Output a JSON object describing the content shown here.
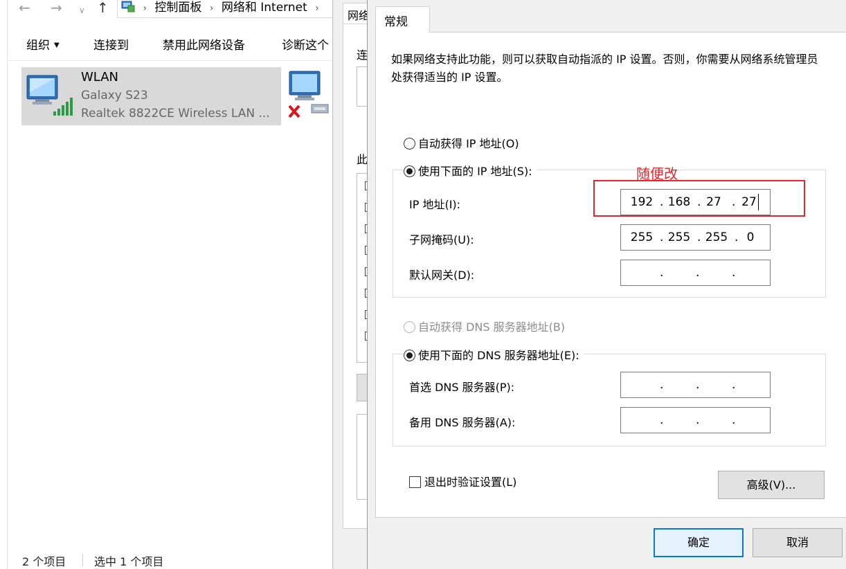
{
  "explorer": {
    "breadcrumb": [
      "控制面板",
      "网络和 Internet"
    ],
    "toolbar": {
      "organize": "组织",
      "connect_to": "连接到",
      "disable_device": "禁用此网络设备",
      "diagnose": "诊断这个"
    },
    "network": {
      "name": "WLAN",
      "ssid": "Galaxy S23",
      "adapter": "Realtek 8822CE Wireless LAN ..."
    },
    "status": {
      "item_count": "2 个项目",
      "selected": "选中 1 个项目"
    }
  },
  "props_window": {
    "tab": "网络",
    "label_connect": "连",
    "label_this": "此"
  },
  "ipv4_dialog": {
    "tab": "常规",
    "description": "如果网络支持此功能，则可以获取自动指派的 IP 设置。否则，你需要从网络系统管理员处获得适当的 IP 设置。",
    "auto_ip_label": "自动获得 IP 地址(O)",
    "manual_ip_label": "使用下面的 IP 地址(S):",
    "ip_label": "IP 地址(I):",
    "ip_octets": [
      "192",
      "168",
      "27",
      "27"
    ],
    "subnet_label": "子网掩码(U):",
    "subnet_octets": [
      "255",
      "255",
      "255",
      "0"
    ],
    "gateway_label": "默认网关(D):",
    "auto_dns_label": "自动获得 DNS 服务器地址(B)",
    "manual_dns_label": "使用下面的 DNS 服务器地址(E):",
    "preferred_dns_label": "首选 DNS 服务器(P):",
    "alternate_dns_label": "备用 DNS 服务器(A):",
    "validate_on_exit_label": "退出时验证设置(L)",
    "advanced_button": "高级(V)...",
    "ok_button": "确定",
    "cancel_button": "取消",
    "annotation": "随便改",
    "ip_dot": "."
  },
  "colors": {
    "annotation": "#e8242a",
    "selection": "#d9d9d9",
    "default_button_border": "#0078d7"
  }
}
